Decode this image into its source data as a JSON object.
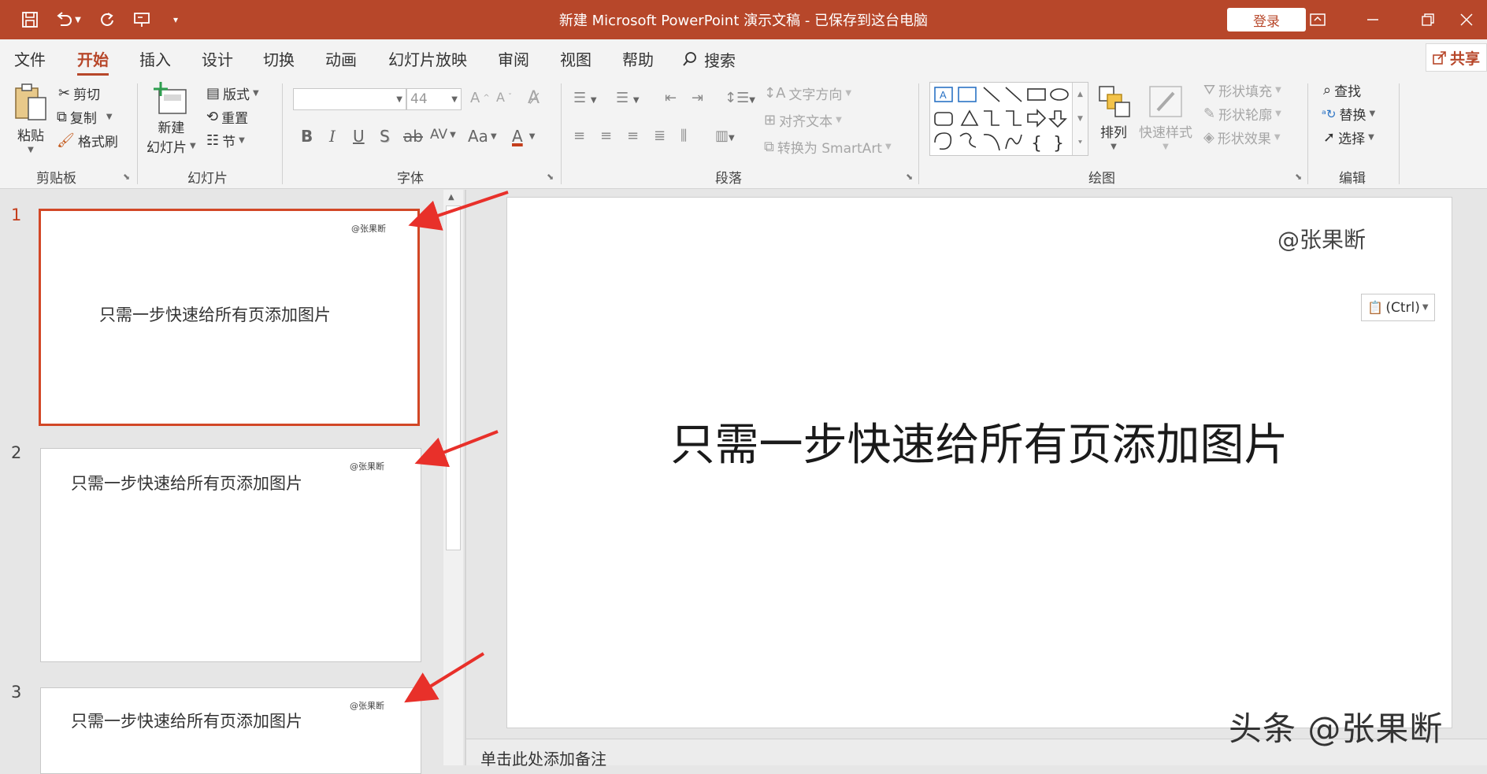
{
  "titlebar": {
    "doc_title": "新建 Microsoft PowerPoint 演示文稿 - 已保存到这台电脑",
    "login_label": "登录",
    "bg_color": "#b7472a",
    "quick_access_icons": [
      "save-icon",
      "undo-icon",
      "redo-icon",
      "present-from-start-icon",
      "customize-icon"
    ],
    "window_icons": [
      "ribbon-display-options-icon",
      "minimize-icon",
      "restore-icon",
      "close-icon"
    ]
  },
  "menu": {
    "tabs": [
      "文件",
      "开始",
      "插入",
      "设计",
      "切换",
      "动画",
      "幻灯片放映",
      "审阅",
      "视图",
      "帮助"
    ],
    "active_tab": "开始",
    "search_label": "搜索",
    "share_label": "共享"
  },
  "ribbon": {
    "clipboard": {
      "label": "剪贴板",
      "paste": "粘贴",
      "cut": "剪切",
      "copy": "复制",
      "format_painter": "格式刷"
    },
    "slides": {
      "label": "幻灯片",
      "new_slide_line1": "新建",
      "new_slide_line2": "幻灯片",
      "layout": "版式",
      "reset": "重置",
      "section": "节"
    },
    "font": {
      "label": "字体",
      "font_name_value": "",
      "font_size_value": "44",
      "bold": "B",
      "italic": "I",
      "underline": "U",
      "shadow": "S",
      "strike": "ab",
      "spacing": "AV",
      "case": "Aa",
      "color": "A"
    },
    "paragraph": {
      "label": "段落",
      "text_direction": "文字方向",
      "align_text": "对齐文本",
      "smartart": "转换为 SmartArt"
    },
    "drawing": {
      "label": "绘图",
      "arrange": "排列",
      "quick_styles": "快速样式",
      "shape_fill": "形状填充",
      "shape_outline": "形状轮廓",
      "shape_effects": "形状效果"
    },
    "editing": {
      "label": "编辑",
      "find": "查找",
      "replace": "替换",
      "select": "选择"
    }
  },
  "slides": [
    {
      "number": "1",
      "watermark": "@张果断",
      "title": "只需一步快速给所有页添加图片",
      "selected": true
    },
    {
      "number": "2",
      "watermark": "@张果断",
      "title": "只需一步快速给所有页添加图片",
      "selected": false
    },
    {
      "number": "3",
      "watermark": "@张果断",
      "title": "只需一步快速给所有页添加图片",
      "selected": false
    }
  ],
  "main_slide": {
    "watermark": "@张果断",
    "title": "只需一步快速给所有页添加图片",
    "paste_options": "(Ctrl)"
  },
  "notes_placeholder": "单击此处添加备注",
  "corner_watermark": "头条 @张果断",
  "accent_color": "#b7472a",
  "annotation_arrow_color": "#e8302a"
}
